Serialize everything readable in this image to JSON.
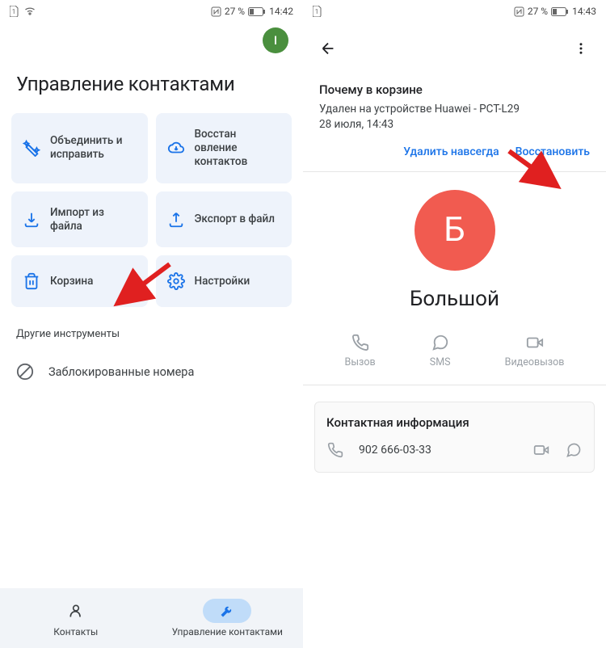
{
  "screen1": {
    "status": {
      "battery": "27 %",
      "time": "14:42"
    },
    "avatar_letter": "I",
    "title": "Управление контактами",
    "tiles": [
      {
        "label": "Объединить и исправить"
      },
      {
        "label": "Восстан овление контактов"
      },
      {
        "label": "Импорт из файла"
      },
      {
        "label": "Экспорт в файл"
      },
      {
        "label": "Корзина"
      },
      {
        "label": "Настройки"
      }
    ],
    "other_tools": "Другие инструменты",
    "blocked": "Заблокированные номера",
    "nav": {
      "contacts": "Контакты",
      "manage": "Управление контактами"
    }
  },
  "screen2": {
    "status": {
      "battery": "27 %",
      "time": "14:43"
    },
    "trash": {
      "title": "Почему в корзине",
      "line1": "Удален на устройстве Huawei - PCT-L29",
      "line2": "28 июля, 14:43",
      "delete": "Удалить навсегда",
      "restore": "Восстановить"
    },
    "contact": {
      "initial": "Б",
      "name": "Большой",
      "actions": {
        "call": "Вызов",
        "sms": "SMS",
        "video": "Видеовызов"
      },
      "info_title": "Контактная информация",
      "phone": "902 666-03-33"
    }
  }
}
